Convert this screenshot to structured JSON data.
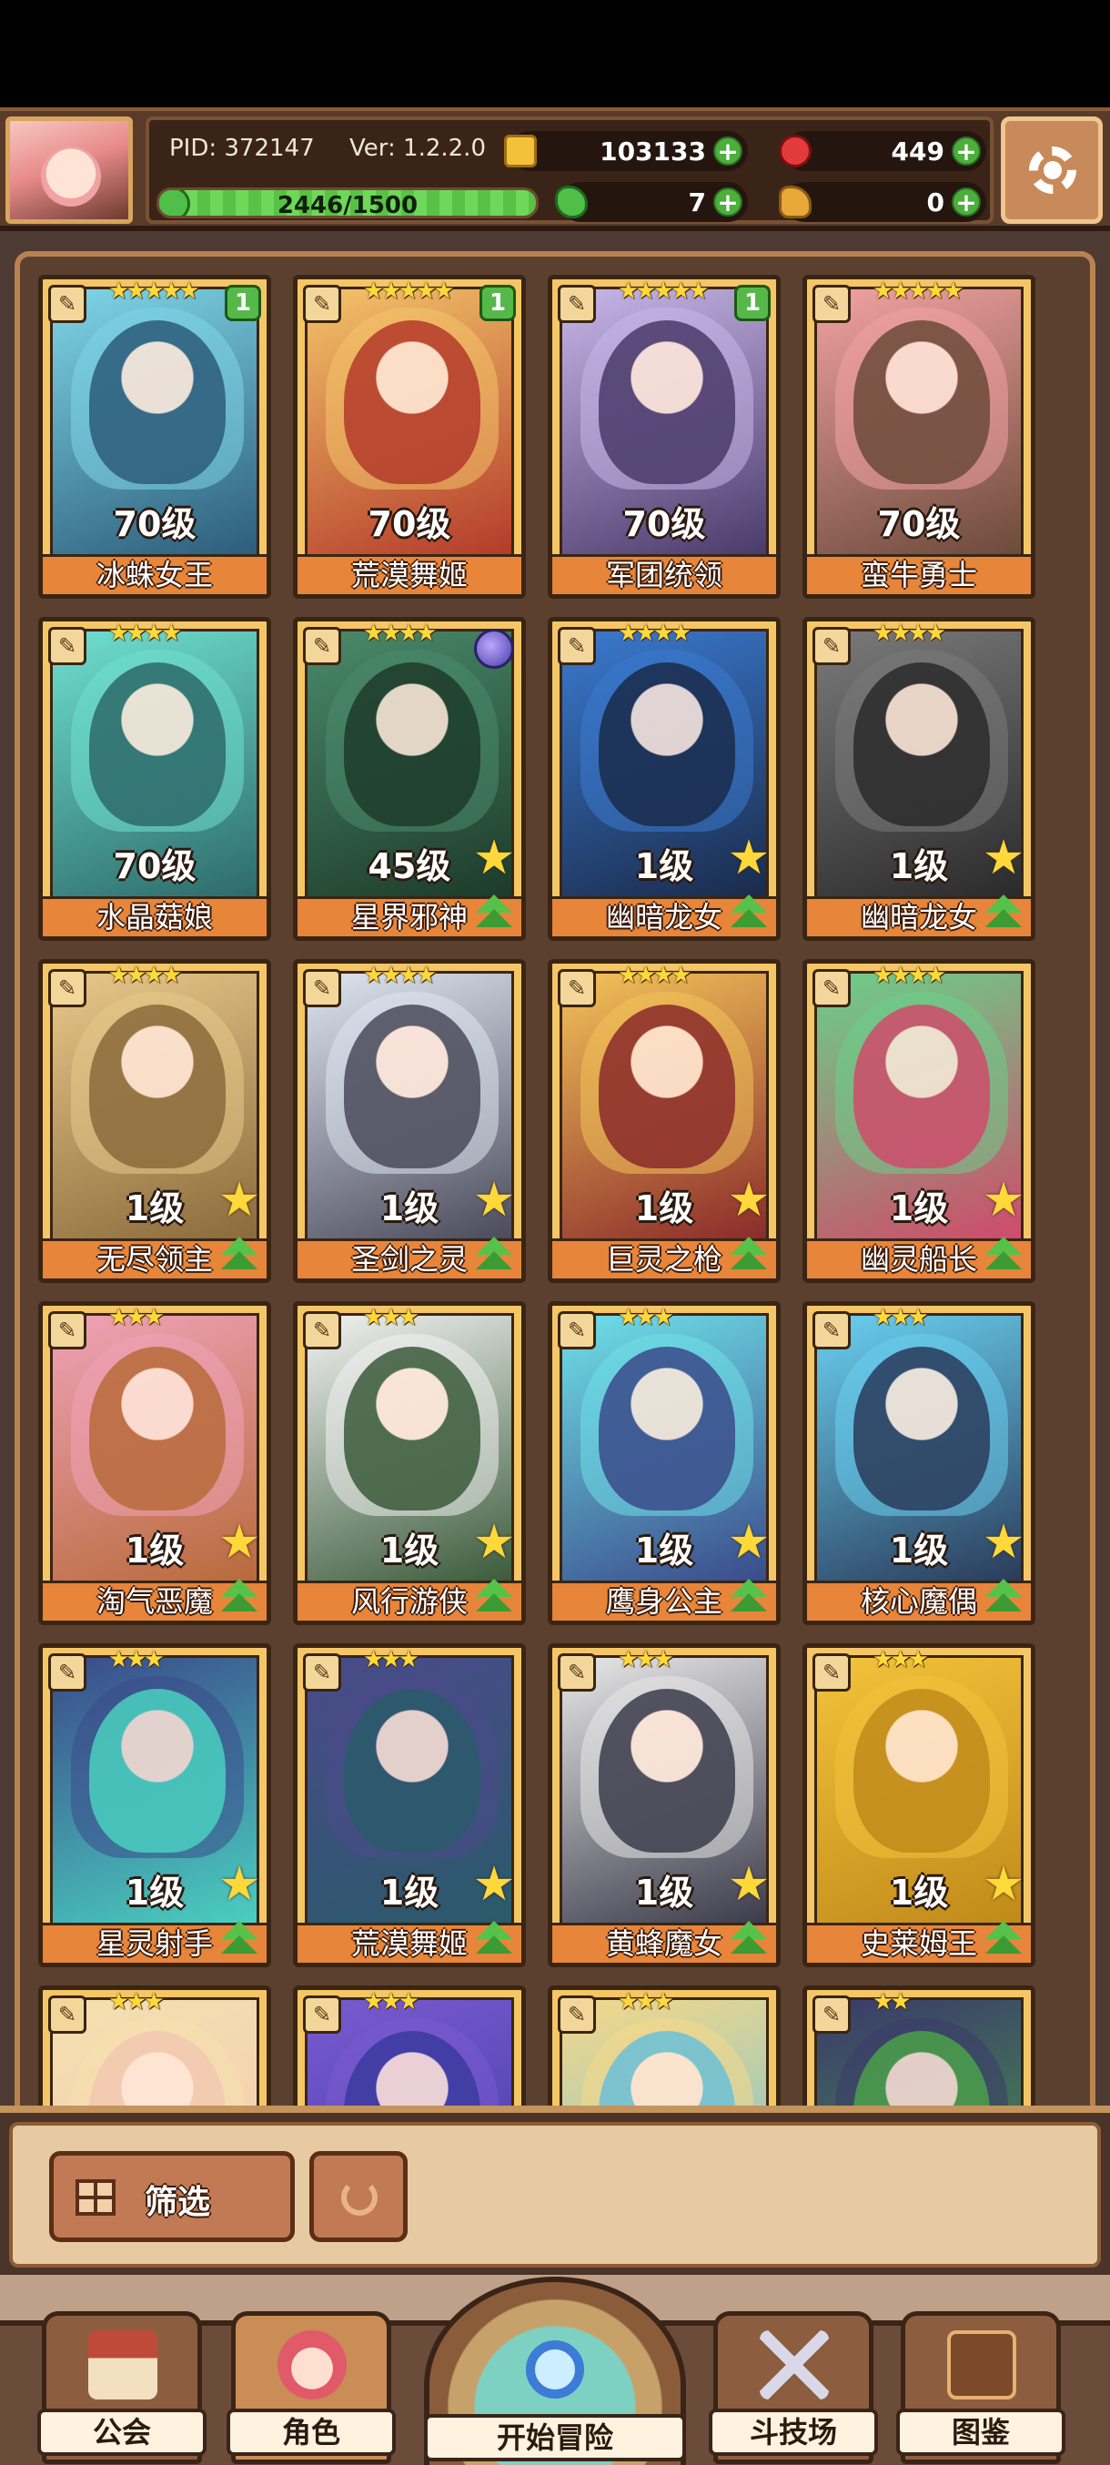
{
  "header": {
    "pid": "PID: 372147",
    "version": "Ver: 1.2.2.0",
    "coins": "103133",
    "gems": "449",
    "clovers": "7",
    "boots": "0",
    "xp": "2446/1500",
    "xp_fill": 1.0
  },
  "cards": [
    {
      "name": "冰蛛女王",
      "level": "70级",
      "stars": "★★★★★",
      "badge": "1",
      "palette": [
        "#7fd6e8",
        "#2c5c7a"
      ]
    },
    {
      "name": "荒漠舞姬",
      "level": "70级",
      "stars": "★★★★★",
      "badge": "1",
      "palette": [
        "#f4c46a",
        "#b33a2a"
      ]
    },
    {
      "name": "军团统领",
      "level": "70级",
      "stars": "★★★★★",
      "badge": "1",
      "palette": [
        "#c9b6e8",
        "#4a3a6a"
      ]
    },
    {
      "name": "蛮牛勇士",
      "level": "70级",
      "stars": "★★★★★",
      "badge": "",
      "palette": [
        "#f2a2a2",
        "#6b4a3a"
      ]
    },
    {
      "name": "水晶菇娘",
      "level": "70级",
      "stars": "★★★★",
      "badge": "",
      "palette": [
        "#6fe0d0",
        "#2d6a6a"
      ]
    },
    {
      "name": "星界邪神",
      "level": "45级",
      "stars": "★★★★",
      "badge": "",
      "palette": [
        "#4a8a6a",
        "#1d3a2a"
      ]
    },
    {
      "name": "幽暗龙女",
      "level": "1级",
      "stars": "★★★★",
      "badge": "",
      "palette": [
        "#3a7acf",
        "#1a2a4a"
      ]
    },
    {
      "name": "幽暗龙女",
      "level": "1级",
      "stars": "★★★★",
      "badge": "",
      "palette": [
        "#7a7a7a",
        "#2a2a2a"
      ]
    },
    {
      "name": "无尽领主",
      "level": "1级",
      "stars": "★★★★",
      "badge": "",
      "palette": [
        "#e8c88a",
        "#8a6a3a"
      ]
    },
    {
      "name": "圣剑之灵",
      "level": "1级",
      "stars": "★★★★",
      "badge": "",
      "palette": [
        "#dfe6f0",
        "#4a4a5a"
      ]
    },
    {
      "name": "巨灵之枪",
      "level": "1级",
      "stars": "★★★★",
      "badge": "",
      "palette": [
        "#f3c35a",
        "#8a2a2a"
      ]
    },
    {
      "name": "幽灵船长",
      "level": "1级",
      "stars": "★★★★",
      "badge": "",
      "palette": [
        "#6ad08a",
        "#d04a6a"
      ]
    },
    {
      "name": "淘气恶魔",
      "level": "1级",
      "stars": "★★★",
      "badge": "",
      "palette": [
        "#f0a2b8",
        "#b86a3a"
      ]
    },
    {
      "name": "风行游侠",
      "level": "1级",
      "stars": "★★★",
      "badge": "",
      "palette": [
        "#f2f2f2",
        "#3a5a3a"
      ]
    },
    {
      "name": "鹰身公主",
      "level": "1级",
      "stars": "★★★",
      "badge": "",
      "palette": [
        "#6fe0e8",
        "#3a4a8a"
      ]
    },
    {
      "name": "核心魔偶",
      "level": "1级",
      "stars": "★★★",
      "badge": "",
      "palette": [
        "#6ad0f0",
        "#2a3a5a"
      ]
    },
    {
      "name": "星灵射手",
      "level": "1级",
      "stars": "★★★",
      "badge": "",
      "palette": [
        "#3a4a8a",
        "#4ad0c0"
      ]
    },
    {
      "name": "荒漠舞姬",
      "level": "1级",
      "stars": "★★★",
      "badge": "",
      "palette": [
        "#4a4a8a",
        "#2a5a6a"
      ]
    },
    {
      "name": "黄蜂魔女",
      "level": "1级",
      "stars": "★★★",
      "badge": "",
      "palette": [
        "#e8e8e8",
        "#3a3a4a"
      ]
    },
    {
      "name": "史莱姆王",
      "level": "1级",
      "stars": "★★★",
      "badge": "",
      "palette": [
        "#f3c33a",
        "#c08a1a"
      ]
    },
    {
      "name": "",
      "level": "",
      "stars": "★★★",
      "badge": "",
      "palette": [
        "#f5e0b0",
        "#f2c8b0"
      ]
    },
    {
      "name": "",
      "level": "",
      "stars": "★★★",
      "badge": "",
      "palette": [
        "#7a5ad0",
        "#3a3aa0"
      ]
    },
    {
      "name": "",
      "level": "",
      "stars": "★★★",
      "badge": "",
      "palette": [
        "#f5d88a",
        "#6ac0d8"
      ]
    },
    {
      "name": "",
      "level": "",
      "stars": "★★",
      "badge": "",
      "palette": [
        "#3a3a6a",
        "#4aa04a"
      ]
    }
  ],
  "filter": {
    "filter_label": "筛选"
  },
  "nav": {
    "guild": "公会",
    "heroes": "角色",
    "adventure": "开始冒险",
    "arena": "斗技场",
    "codex": "图鉴"
  }
}
